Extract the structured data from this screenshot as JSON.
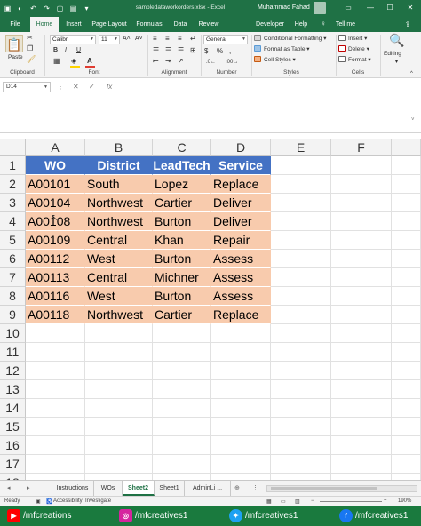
{
  "window": {
    "file_name": "sampledataworkorders.xlsx",
    "app_name": "Excel",
    "title_separator": "-",
    "user": "Muhammad Fahad"
  },
  "tabs": [
    {
      "label": "File"
    },
    {
      "label": "Home",
      "active": true
    },
    {
      "label": "Insert"
    },
    {
      "label": "Page Layout"
    },
    {
      "label": "Formulas"
    },
    {
      "label": "Data"
    },
    {
      "label": "Review"
    },
    {
      "label": "Developer"
    },
    {
      "label": "Help"
    },
    {
      "label": "Tell me"
    }
  ],
  "ribbon": {
    "clipboard": {
      "paste": "Paste",
      "label": "Clipboard"
    },
    "font": {
      "name": "Calibri",
      "size": "11",
      "bold": "B",
      "italic": "I",
      "underline": "U",
      "label": "Font"
    },
    "alignment": {
      "label": "Alignment"
    },
    "number": {
      "format": "General",
      "label": "Number"
    },
    "styles": {
      "conditional": "Conditional Formatting",
      "table": "Format as Table",
      "cell_styles": "Cell Styles",
      "label": "Styles"
    },
    "cells": {
      "insert": "Insert",
      "delete": "Delete",
      "format": "Format",
      "label": "Cells"
    },
    "editing": {
      "label": "Editing"
    },
    "colors": {
      "font_color": "#e03c31",
      "fill_color": "#ffd400"
    }
  },
  "formula_bar": {
    "name_box": "D14",
    "cancel": "✕",
    "enter": "✓",
    "fx": "fx",
    "value": ""
  },
  "grid": {
    "columns": [
      "A",
      "B",
      "C",
      "D",
      "E",
      "F"
    ],
    "rows": [
      "1",
      "2",
      "3",
      "4",
      "5",
      "6",
      "7",
      "8",
      "9",
      "10",
      "11",
      "12",
      "13",
      "14",
      "15",
      "16",
      "17",
      "18"
    ],
    "header": [
      "WO",
      "District",
      "LeadTech",
      "Service"
    ],
    "data": [
      [
        "A00101",
        "South",
        "Lopez",
        "Replace"
      ],
      [
        "A00104",
        "Northwest",
        "Cartier",
        "Deliver"
      ],
      [
        "A00108",
        "Northwest",
        "Burton",
        "Deliver"
      ],
      [
        "A00109",
        "Central",
        "Khan",
        "Repair"
      ],
      [
        "A00112",
        "West",
        "Burton",
        "Assess"
      ],
      [
        "A00113",
        "Central",
        "Michner",
        "Assess"
      ],
      [
        "A00116",
        "West",
        "Burton",
        "Assess"
      ],
      [
        "A00118",
        "Northwest",
        "Cartier",
        "Replace"
      ]
    ],
    "header_color": "#4472c4",
    "data_color": "#f8cbad"
  },
  "sheets": [
    {
      "label": "Instructions"
    },
    {
      "label": "WOs"
    },
    {
      "label": "Sheet2",
      "active": true
    },
    {
      "label": "Sheet1"
    },
    {
      "label": "AdminLi ..."
    }
  ],
  "status": {
    "ready": "Ready",
    "accessibility": "Accessibility: Investigate",
    "zoom": "190%"
  },
  "social": [
    {
      "handle": "/mfcreations",
      "icon": "youtube-icon",
      "color": "#ff0000"
    },
    {
      "handle": "/mfcreatives1",
      "icon": "instagram-icon",
      "color": "#d6249f"
    },
    {
      "handle": "/mfcreatives1",
      "icon": "twitter-icon",
      "color": "#1da1f2"
    },
    {
      "handle": "/mfcreatives1",
      "icon": "facebook-icon",
      "color": "#1877f2"
    }
  ]
}
